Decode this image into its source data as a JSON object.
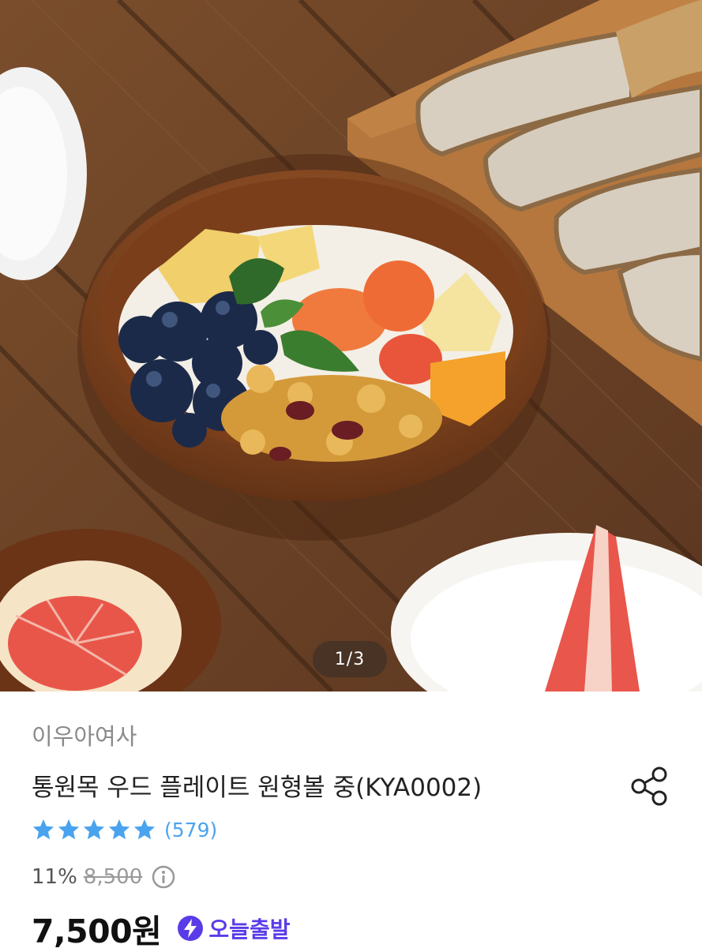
{
  "gallery": {
    "pager": "1/3",
    "image_alt": "wooden bowl with yogurt, blueberries, grapefruit and granola on a wooden table with bread"
  },
  "product": {
    "brand": "이우아여사",
    "title": "통원목 우드 플레이트 원형볼 중(KYA0002)",
    "rating_stars": 5,
    "review_count": "(579)",
    "discount": "11%",
    "original_price": "8,500",
    "final_price": "7,500원",
    "delivery_badge": "오늘출발"
  },
  "icons": {
    "share": "share-icon",
    "info": "info-icon",
    "bolt": "lightning-bolt-icon",
    "star": "star-icon"
  },
  "colors": {
    "star": "#4aa3ee",
    "badge": "#5b3be8",
    "final_price": "#111111"
  }
}
